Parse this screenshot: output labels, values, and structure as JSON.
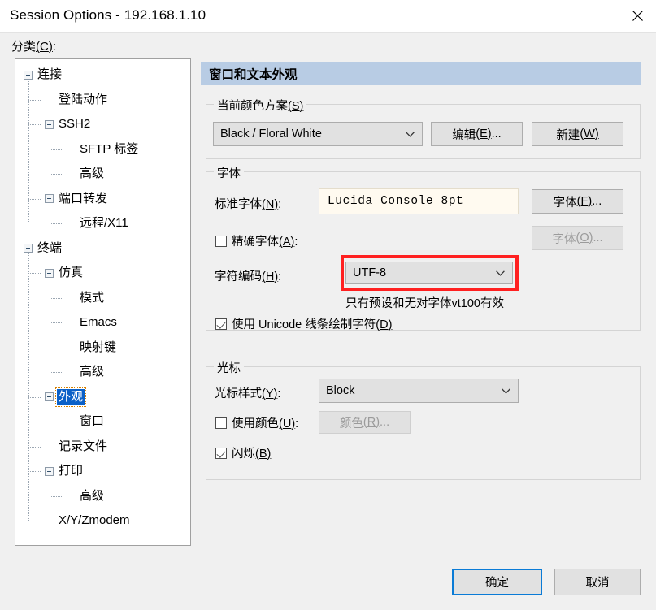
{
  "window": {
    "title": "Session Options - 192.168.1.10",
    "close_icon": "close-icon"
  },
  "left": {
    "category_label": "分类",
    "category_mnemonic": "C",
    "category_suffix": ":",
    "tree": [
      {
        "label": "连接",
        "level": 0,
        "expander": "minus",
        "selected": false
      },
      {
        "label": "登陆动作",
        "level": 1,
        "expander": "none",
        "selected": false
      },
      {
        "label": "SSH2",
        "level": 1,
        "expander": "minus",
        "selected": false
      },
      {
        "label": "SFTP 标签",
        "level": 2,
        "expander": "none",
        "selected": false
      },
      {
        "label": "高级",
        "level": 2,
        "expander": "none",
        "selected": false
      },
      {
        "label": "端口转发",
        "level": 1,
        "expander": "minus",
        "selected": false
      },
      {
        "label": "远程/X11",
        "level": 2,
        "expander": "none",
        "selected": false
      },
      {
        "label": "终端",
        "level": 0,
        "expander": "minus",
        "selected": false
      },
      {
        "label": "仿真",
        "level": 1,
        "expander": "minus",
        "selected": false
      },
      {
        "label": "模式",
        "level": 2,
        "expander": "none",
        "selected": false
      },
      {
        "label": "Emacs",
        "level": 2,
        "expander": "none",
        "selected": false
      },
      {
        "label": "映射键",
        "level": 2,
        "expander": "none",
        "selected": false
      },
      {
        "label": "高级",
        "level": 2,
        "expander": "none",
        "selected": false
      },
      {
        "label": "外观",
        "level": 1,
        "expander": "minus",
        "selected": true
      },
      {
        "label": "窗口",
        "level": 2,
        "expander": "none",
        "selected": false
      },
      {
        "label": "记录文件",
        "level": 1,
        "expander": "none",
        "selected": false
      },
      {
        "label": "打印",
        "level": 1,
        "expander": "minus",
        "selected": false
      },
      {
        "label": "高级",
        "level": 2,
        "expander": "none",
        "selected": false
      },
      {
        "label": "X/Y/Zmodem",
        "level": 1,
        "expander": "none",
        "selected": false
      }
    ]
  },
  "panel": {
    "header": "窗口和文本外观",
    "color_scheme": {
      "group_label": "当前颜色方案",
      "group_mnemonic": "S",
      "selected": "Black / Floral White",
      "edit_label": "编辑",
      "edit_mnemonic": "E",
      "edit_suffix": "...",
      "new_label": "新建",
      "new_mnemonic": "W"
    },
    "font": {
      "group_label": "字体",
      "normal_label": "标准字体",
      "normal_mnemonic": "N",
      "normal_suffix": ":",
      "normal_value": "Lucida Console 8pt",
      "font_button_label": "字体",
      "font_button_mnemonic": "F",
      "font_button_suffix": "...",
      "exact_label": "精确字体",
      "exact_mnemonic": "A",
      "exact_suffix": ":",
      "exact_checked": false,
      "font_button2_label": "字体",
      "font_button2_mnemonic": "O",
      "font_button2_suffix": "...",
      "font_button2_disabled": true,
      "charset_label": "字符编码",
      "charset_mnemonic": "H",
      "charset_suffix": ":",
      "charset_value": "UTF-8",
      "charset_hint": "只有预设和无对字体vt100有效",
      "unicode_line_label_pre": "使用 Unicode 线条绘制字符",
      "unicode_line_mnemonic": "D",
      "unicode_line_checked": true
    },
    "cursor": {
      "group_label": "光标",
      "style_label": "光标样式",
      "style_mnemonic": "Y",
      "style_suffix": ":",
      "style_value": "Block",
      "use_color_label": "使用颜色",
      "use_color_mnemonic": "U",
      "use_color_suffix": ":",
      "use_color_checked": false,
      "color_button_label": "颜色",
      "color_button_mnemonic": "R",
      "color_button_suffix": "...",
      "color_button_disabled": true,
      "blink_label": "闪烁",
      "blink_mnemonic": "B",
      "blink_checked": true
    }
  },
  "footer": {
    "ok_label": "确定",
    "cancel_label": "取消"
  },
  "annotation": {
    "highlight_color": "#ff2020",
    "target": "charset-combo"
  }
}
